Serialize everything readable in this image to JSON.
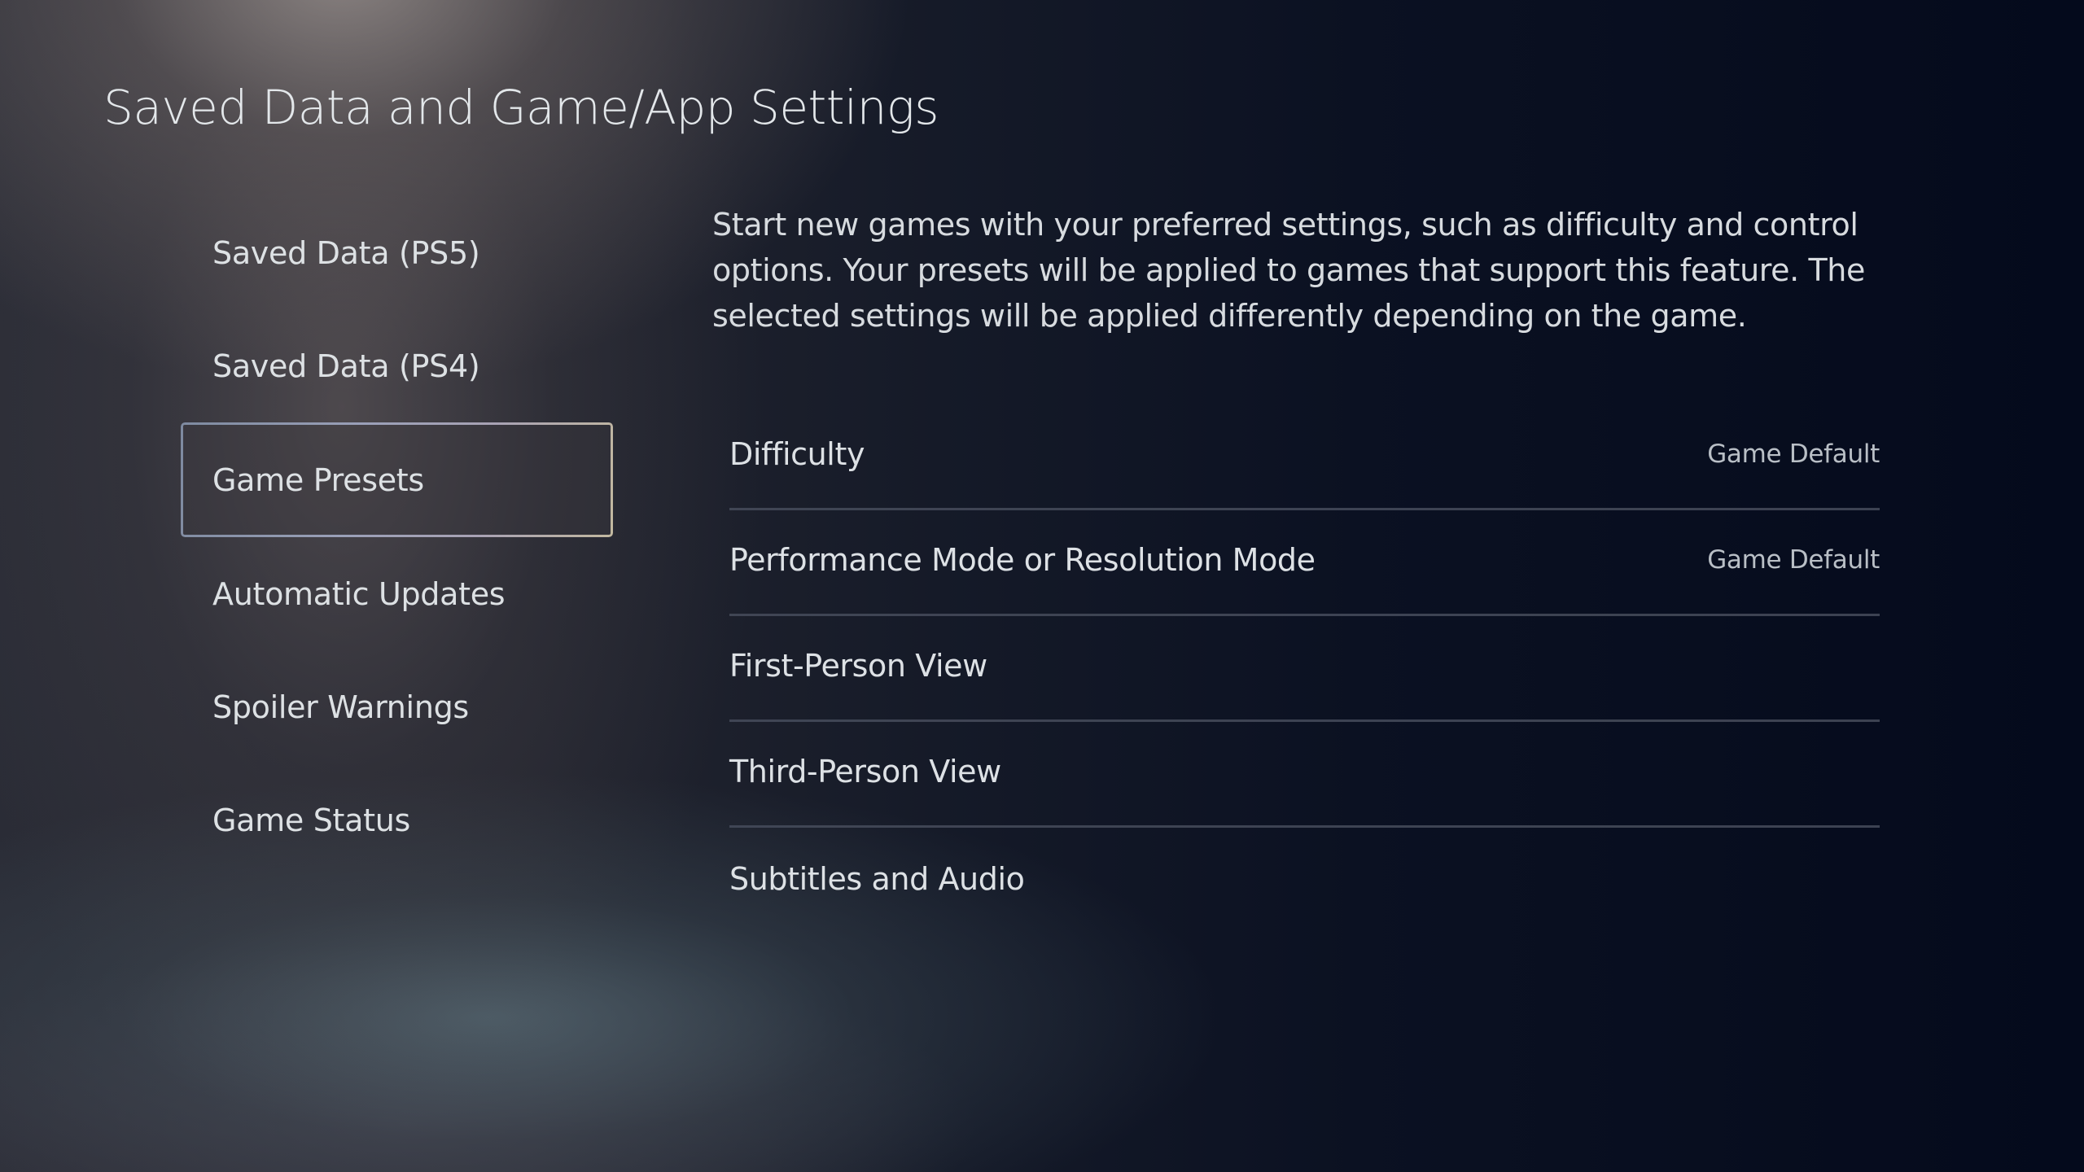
{
  "header": {
    "title": "Saved Data and Game/App Settings"
  },
  "sidebar": {
    "selected_index": 2,
    "items": [
      {
        "label": "Saved Data (PS5)"
      },
      {
        "label": "Saved Data (PS4)"
      },
      {
        "label": "Game Presets"
      },
      {
        "label": "Automatic Updates"
      },
      {
        "label": "Spoiler Warnings"
      },
      {
        "label": "Game Status"
      }
    ]
  },
  "main": {
    "description": "Start new games with your preferred settings, such as difficulty and control options. Your presets will be applied to games that support this feature. The selected settings will be applied differently depending on the game.",
    "options": [
      {
        "label": "Difficulty",
        "value": "Game Default"
      },
      {
        "label": "Performance Mode or Resolution Mode",
        "value": "Game Default"
      },
      {
        "label": "First-Person View",
        "value": ""
      },
      {
        "label": "Third-Person View",
        "value": ""
      },
      {
        "label": "Subtitles and Audio",
        "value": ""
      }
    ]
  },
  "colors": {
    "background_dark": "#040a1c",
    "text_primary": "#dde1e5",
    "text_secondary": "#b9bfc6",
    "focus_border_start": "#7e8aa0",
    "focus_border_end": "#c2b8a0"
  }
}
